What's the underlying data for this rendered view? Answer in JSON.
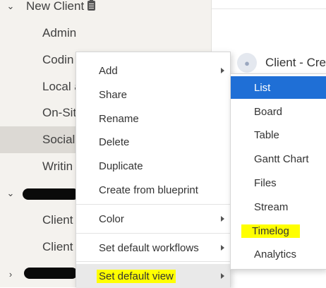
{
  "sidebar": {
    "items": [
      {
        "label": "New Client",
        "kind": "folder",
        "expanded": true
      },
      {
        "label": "Admin",
        "kind": "child"
      },
      {
        "label": "Codin",
        "kind": "child"
      },
      {
        "label": "Local a",
        "kind": "child"
      },
      {
        "label": "On-Sit",
        "kind": "child"
      },
      {
        "label": "Social",
        "kind": "child",
        "selected": true
      },
      {
        "label": "Writin",
        "kind": "child"
      },
      {
        "label": "",
        "kind": "folder",
        "redacted": true,
        "expanded": true
      },
      {
        "label": "Client",
        "kind": "child"
      },
      {
        "label": "Client",
        "kind": "child"
      },
      {
        "label": "",
        "kind": "folder",
        "redacted": true,
        "expanded": false
      }
    ],
    "clipboard_icon": "clipboard-icon"
  },
  "main": {
    "client_label": "Client - Cre",
    "avatar_icon": "people-icon"
  },
  "context_menu": {
    "items": [
      {
        "label": "Add",
        "has_submenu": true
      },
      {
        "label": "Share"
      },
      {
        "label": "Rename"
      },
      {
        "label": "Delete"
      },
      {
        "label": "Duplicate"
      },
      {
        "label": "Create from blueprint"
      },
      {
        "label": "Color",
        "has_submenu": true
      },
      {
        "label": "Set default workflows",
        "has_submenu": true
      },
      {
        "label": "Set default view",
        "has_submenu": true,
        "active": true,
        "highlighted": true
      }
    ]
  },
  "submenu": {
    "items": [
      {
        "label": "List",
        "selected": true
      },
      {
        "label": "Board"
      },
      {
        "label": "Table"
      },
      {
        "label": "Gantt Chart"
      },
      {
        "label": "Files"
      },
      {
        "label": "Stream"
      },
      {
        "label": "Timelog",
        "highlighted": true
      },
      {
        "label": "Analytics"
      }
    ]
  },
  "colors": {
    "sidebar_bg": "#f4f2ee",
    "selected_row": "#dcd9d4",
    "accent_blue": "#1f6fd6",
    "highlight_yellow": "#ffff00"
  }
}
